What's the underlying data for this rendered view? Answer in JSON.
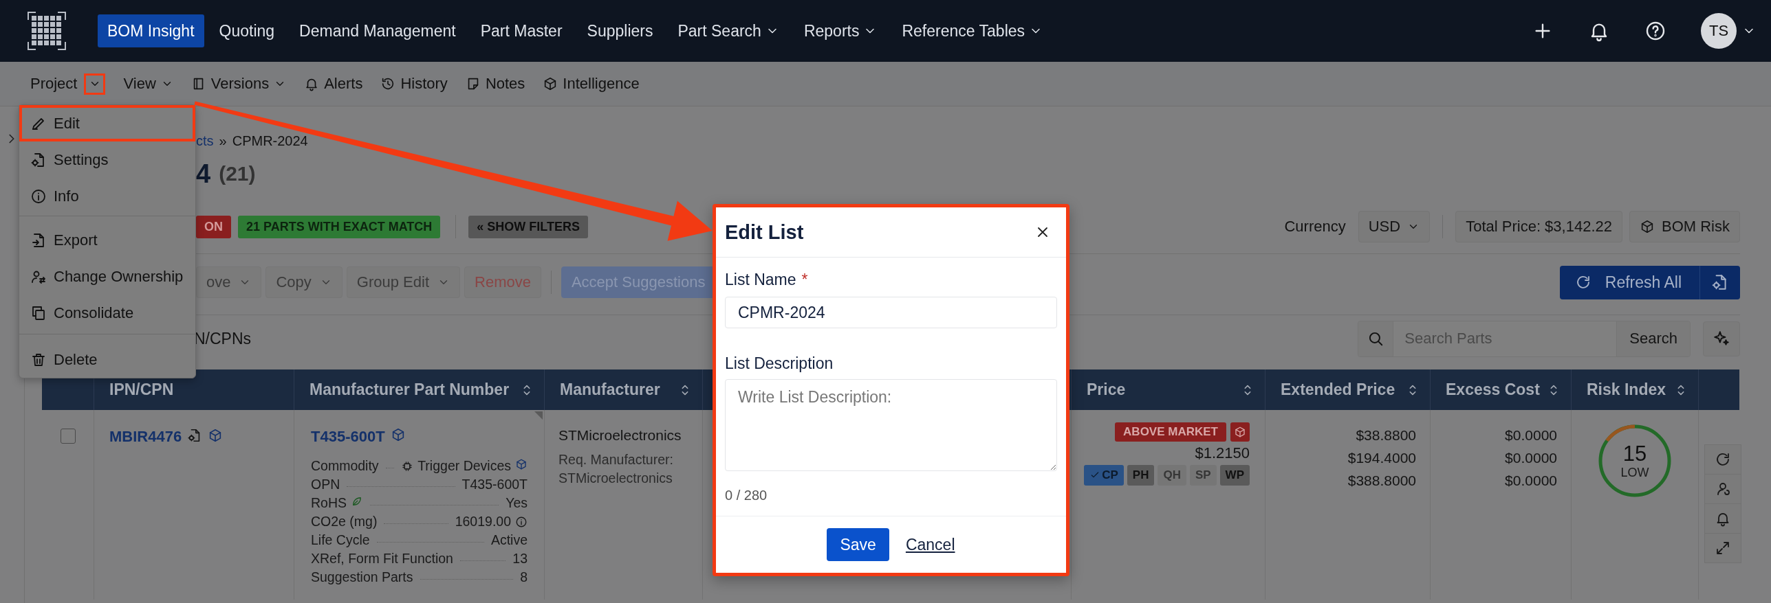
{
  "top_nav": {
    "items": [
      {
        "label": "BOM Insight",
        "selected": true,
        "dropdown": false
      },
      {
        "label": "Quoting",
        "selected": false,
        "dropdown": false
      },
      {
        "label": "Demand Management",
        "selected": false,
        "dropdown": false
      },
      {
        "label": "Part Master",
        "selected": false,
        "dropdown": false
      },
      {
        "label": "Suppliers",
        "selected": false,
        "dropdown": false
      },
      {
        "label": "Part Search",
        "selected": false,
        "dropdown": true
      },
      {
        "label": "Reports",
        "selected": false,
        "dropdown": true
      },
      {
        "label": "Reference Tables",
        "selected": false,
        "dropdown": true
      }
    ],
    "user_initials": "TS"
  },
  "project_toolbar": {
    "items": [
      {
        "label": "Project",
        "dropdown": true,
        "highlighted": true
      },
      {
        "label": "View",
        "dropdown": true,
        "highlighted": false
      },
      {
        "label": "Versions",
        "dropdown": true,
        "highlighted": false
      },
      {
        "label": "Alerts",
        "dropdown": false,
        "highlighted": false
      },
      {
        "label": "History",
        "dropdown": false,
        "highlighted": false
      },
      {
        "label": "Notes",
        "dropdown": false,
        "highlighted": false
      },
      {
        "label": "Intelligence",
        "dropdown": false,
        "highlighted": false
      }
    ]
  },
  "project_menu": {
    "sections": [
      {
        "items": [
          {
            "label": "Edit",
            "highlighted": true
          },
          {
            "label": "Settings",
            "highlighted": false
          },
          {
            "label": "Info",
            "highlighted": false
          }
        ]
      },
      {
        "items": [
          {
            "label": "Export",
            "highlighted": false
          },
          {
            "label": "Change Ownership",
            "highlighted": false
          },
          {
            "label": "Consolidate",
            "highlighted": false
          }
        ]
      },
      {
        "items": [
          {
            "label": "Delete",
            "highlighted": false
          }
        ]
      }
    ]
  },
  "breadcrumb": {
    "link": "cts",
    "separator": "»",
    "current": "CPMR-2024"
  },
  "title": {
    "name": "4",
    "count": "(21)"
  },
  "status_badges": [
    {
      "label": "ON",
      "color": "#8a1f1f"
    },
    {
      "label": "21 PARTS WITH EXACT MATCH",
      "color": "#2d7a34"
    }
  ],
  "filters_button": "« SHOW FILTERS",
  "currency": {
    "label": "Currency",
    "value": "USD"
  },
  "total_price": "Total Price: $3,142.22",
  "bom_risk_button": "BOM Risk",
  "actions": [
    {
      "label": "ove",
      "kind": "dropdown"
    },
    {
      "label": "Copy",
      "kind": "dropdown"
    },
    {
      "label": "Group Edit",
      "kind": "dropdown"
    },
    {
      "label": "Remove",
      "kind": "danger"
    },
    {
      "label": "Accept Suggestions",
      "kind": "primary"
    }
  ],
  "refresh_button": "Refresh All",
  "list_caption": "N/CPNs",
  "search": {
    "placeholder": "Search Parts",
    "button": "Search"
  },
  "table": {
    "columns": [
      {
        "label": "IPN/CPN",
        "sortable": false
      },
      {
        "label": "Manufacturer Part Number",
        "sortable": true
      },
      {
        "label": "Manufacturer",
        "sortable": true
      },
      {
        "label": "Price",
        "sortable": true
      },
      {
        "label": "Extended Price",
        "sortable": true
      },
      {
        "label": "Excess Cost",
        "sortable": true
      },
      {
        "label": "Risk Index",
        "sortable": true
      }
    ],
    "rows": [
      {
        "checked": false,
        "ipn": "MBIR4476",
        "mpn": "T435-600T",
        "attributes": [
          {
            "label": "Commodity",
            "value": "Trigger Devices"
          },
          {
            "label": "OPN",
            "value": "T435-600T"
          },
          {
            "label": "RoHS",
            "value": "Yes"
          },
          {
            "label": "CO2e (mg)",
            "value": "16019.00"
          },
          {
            "label": "Life Cycle",
            "value": "Active"
          },
          {
            "label": "XRef, Form Fit Function",
            "value": "13"
          },
          {
            "label": "Suggestion Parts",
            "value": "8"
          }
        ],
        "manufacturer": "STMicroelectronics",
        "req_manufacturer": "Req. Manufacturer: STMicroelectronics",
        "price": {
          "tag": "ABOVE MARKET",
          "value": "$1.2150",
          "sources": [
            {
              "label": "CP",
              "selected": true,
              "available": true
            },
            {
              "label": "PH",
              "selected": false,
              "available": true
            },
            {
              "label": "QH",
              "selected": false,
              "available": false
            },
            {
              "label": "SP",
              "selected": false,
              "available": false
            },
            {
              "label": "WP",
              "selected": false,
              "available": true
            }
          ]
        },
        "extended_price": [
          "$38.8800",
          "$194.4000",
          "$388.8000"
        ],
        "excess_cost": [
          "$0.0000",
          "$0.0000",
          "$0.0000"
        ],
        "risk": {
          "score": "15",
          "rating": "LOW"
        }
      }
    ]
  },
  "edit_modal": {
    "title": "Edit List",
    "highlighted": true,
    "fields": [
      {
        "label": "List Name",
        "required_mark": "*",
        "kind": "input",
        "value": "CPMR-2024"
      },
      {
        "label": "List Description",
        "kind": "textarea",
        "placeholder": "Write List Description:"
      }
    ],
    "counter": "0 / 280",
    "buttons": [
      {
        "label": "Save",
        "kind": "primary"
      },
      {
        "label": "Cancel",
        "kind": "link"
      }
    ]
  },
  "callout_arrow": true
}
